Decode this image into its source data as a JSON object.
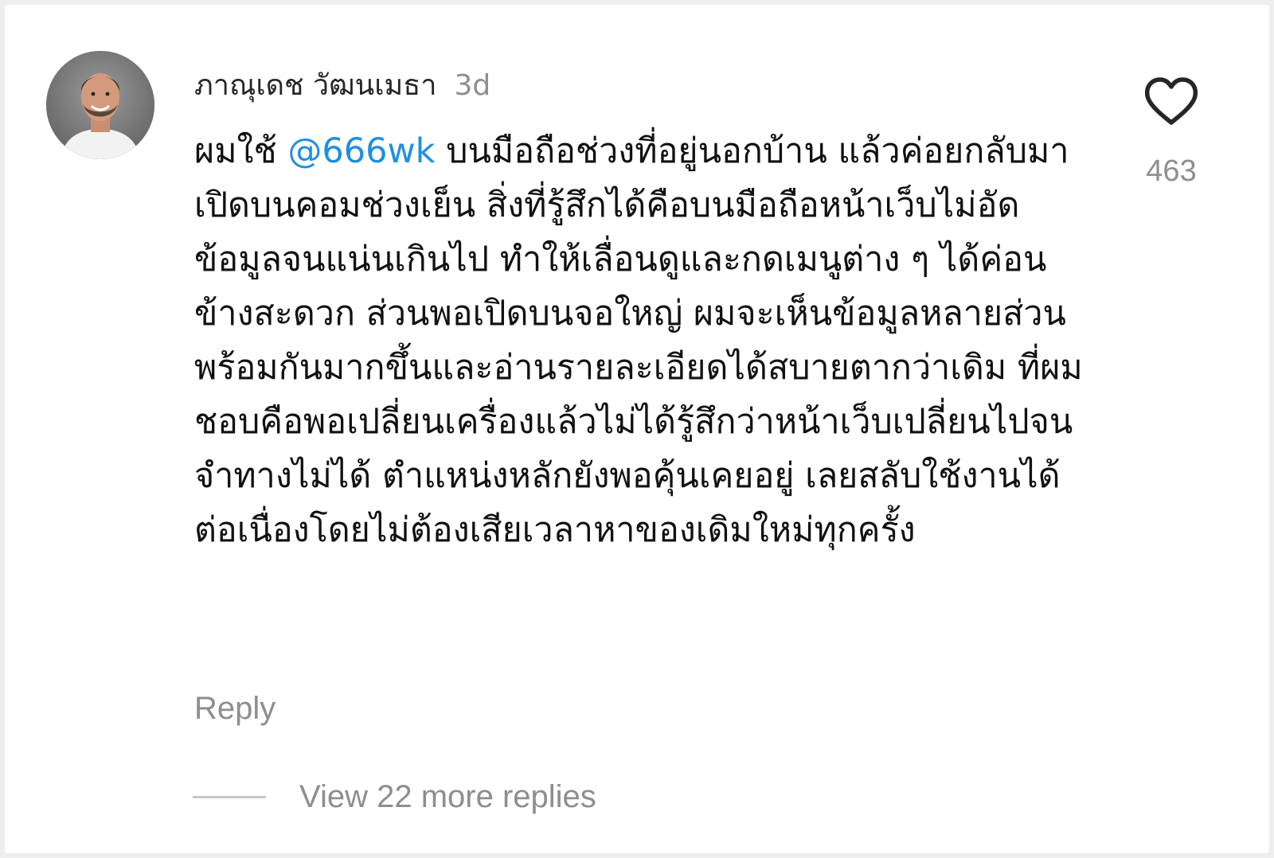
{
  "comment": {
    "author": "ภาณุเดช วัฒนเมธา",
    "time_ago": "3d",
    "text_before_mention": "ผมใช้ ",
    "mention": "@666wk",
    "text_after_mention": " บนมือถือช่วงที่อยู่นอกบ้าน แล้วค่อยกลับมาเปิดบนคอมช่วงเย็น สิ่งที่รู้สึกได้คือบนมือถือหน้าเว็บไม่อัดข้อมูลจนแน่นเกินไป ทำให้เลื่อนดูและกดเมนูต่าง ๆ ได้ค่อนข้างสะดวก ส่วนพอเปิดบนจอใหญ่ ผมจะเห็นข้อมูลหลายส่วนพร้อมกันมากขึ้นและอ่านรายละเอียดได้สบายตากว่าเดิม ที่ผมชอบคือพอเปลี่ยนเครื่องแล้วไม่ได้รู้สึกว่าหน้าเว็บเปลี่ยนไปจนจำทางไม่ได้ ตำแหน่งหลักยังพอคุ้นเคยอยู่ เลยสลับใช้งานได้ต่อเนื่องโดยไม่ต้องเสียเวลาหาของเดิมใหม่ทุกครั้ง",
    "like_count": "463",
    "reply_label": "Reply",
    "view_replies_label": "View 22 more replies"
  },
  "icons": {
    "like": "heart-outline-icon",
    "avatar": "user-avatar"
  },
  "colors": {
    "mention": "#1d8fe1",
    "secondary_text": "#8e8e8e",
    "primary_text": "#111111"
  }
}
